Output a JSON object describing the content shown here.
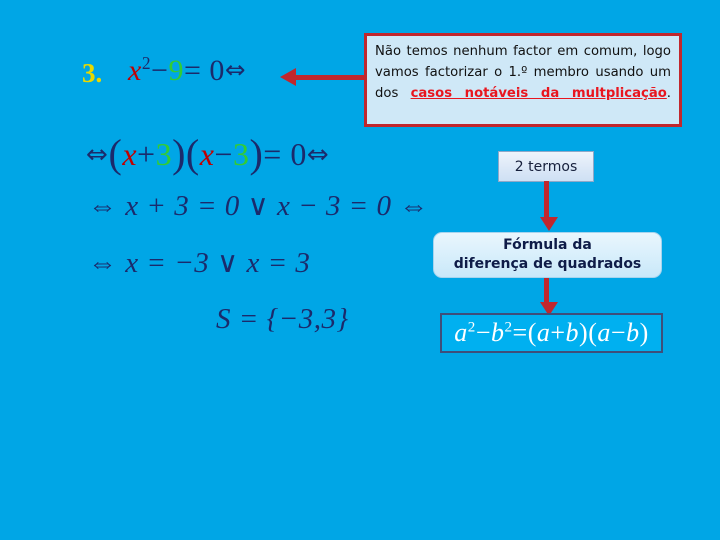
{
  "slide": {
    "background_color": "#00a6e6",
    "item_number": "3."
  },
  "equations": {
    "line1": {
      "var": "x",
      "exponent": "2",
      "minus": "−",
      "nine": "9",
      "equals_zero": "= 0",
      "iff": "⇔"
    },
    "line2": {
      "iff_start": "⇔",
      "open1": "(",
      "var1": "x",
      "plus": "+",
      "three1": "3",
      "close1": ")",
      "open2": "(",
      "var2": "x",
      "minus": "−",
      "three2": "3",
      "close2": ")",
      "equals_zero": "= 0",
      "iff_end": "⇔"
    },
    "line3": {
      "text": "⇔ x + 3 = 0 ∨ x − 3 = 0 ⇔"
    },
    "line4": {
      "text": "⇔ x = −3 ∨ x = 3"
    },
    "line5": {
      "text": "S = {−3,3}"
    }
  },
  "callout": {
    "text_plain": "Não temos nenhum factor em comum, logo vamos factorizar o 1.º membro usando um dos casos notáveis da multplicação.",
    "part1": "Não temos nenhum factor em comum, logo vamos factorizar o 1.º membro usando um dos ",
    "highlight": "casos notáveis da multplicação",
    "part2": ".",
    "border_color": "#c1272d",
    "background_color": "#cfe8f7",
    "highlight_color": "#e8161f"
  },
  "terms_box": {
    "label": "2 termos"
  },
  "formula_title_box": {
    "line1": "Fórmula da",
    "line2": "diferença de quadrados"
  },
  "formula_box": {
    "a": "a",
    "exp_a": "2",
    "minus": "−",
    "b": "b",
    "exp_b": "2",
    "equals": "=",
    "open1": "(",
    "a2": "a",
    "plus": "+",
    "b2": "b",
    "close1": ")",
    "open2": "(",
    "a3": "a",
    "minus2": "−",
    "b3": "b",
    "close2": ")",
    "text_plain": "a² − b² = (a + b)(a − b)",
    "border_color": "#3f4e7a",
    "background_color": "#00b0f0",
    "text_color": "#ffffff"
  },
  "arrows": {
    "left_arrow_color": "#c1272d",
    "down_arrow_1_color": "#c1272d",
    "down_arrow_2_color": "#c1272d"
  },
  "colors": {
    "math_navy": "#1b2a6b",
    "variable_red": "#c00000",
    "number_green": "#33cc33",
    "item_number_yellow": "#e8d900"
  }
}
